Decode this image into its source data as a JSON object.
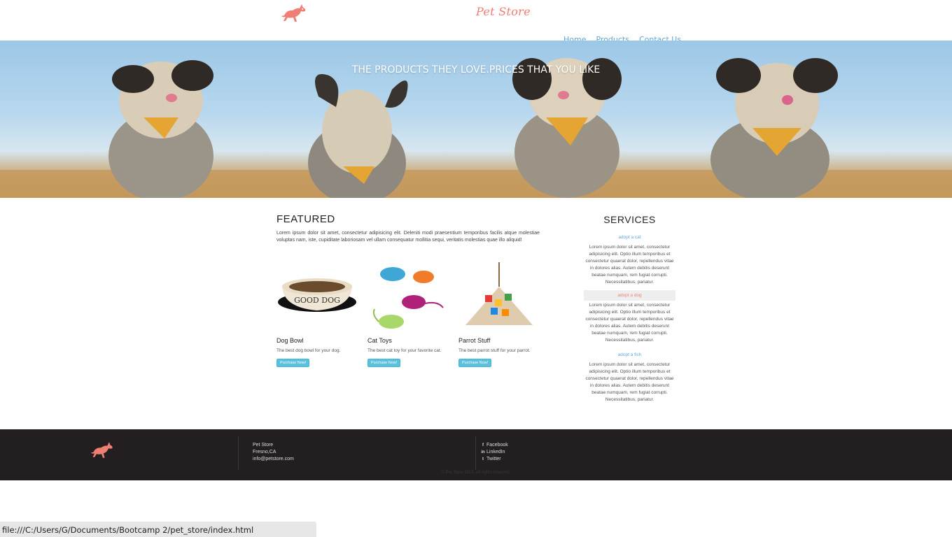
{
  "header": {
    "brand": "Pet Store",
    "nav": [
      "Home",
      "Products",
      "Contact Us"
    ]
  },
  "hero": {
    "caption": "THE PRODUCTS THEY LOVE.PRICES THAT YOU LIKE"
  },
  "featured": {
    "title": "FEATURED",
    "description": "Lorem ipsum dolor sit amet, consectetur adipisicing elit. Deleniti modi praesentium temporibus facilis atque molestiae voluptas nam, iste, cupiditate laboriosam vel ullam consequatur mollitia sequi, veritatis molestias quae illo aliquid!",
    "products": [
      {
        "name": "Dog Bowl",
        "description": "The best dog bowl for your dog.",
        "button": "Purchase Now!",
        "image_text": "GOOD DOG"
      },
      {
        "name": "Cat Toys",
        "description": "The best cat toy for your favorite cat.",
        "button": "Purchase Now!"
      },
      {
        "name": "Parrot Stuff",
        "description": "The best parrot stuff for your parrot.",
        "button": "Purchase Now!"
      }
    ]
  },
  "services": {
    "title": "SERVICES",
    "items": [
      {
        "label": "adopt a cat",
        "text": "Lorem ipsum dolor sit amet, consectetur adipisicing elit. Optio illum temporibus et consectetur quaerat dolor, repellendus vitae in dolores alias. Autem debitis deserunt beatae numquam, rem fugiat corrupti. Necessitatibus, pariatur."
      },
      {
        "label": "adopt a dog",
        "text": "Lorem ipsum dolor sit amet, consectetur adipisicing elit. Optio illum temporibus et consectetur quaerat dolor, repellendus vitae in dolores alias. Autem debitis deserunt beatae numquam, rem fugiat corrupti. Necessitatibus, pariatur."
      },
      {
        "label": "adopt a fish",
        "text": "Lorem ipsum dolor sit amet, consectetur adipisicing elit. Optio illum temporibus et consectetur quaerat dolor, repellendus vitae in dolores alias. Autem debitis deserunt beatae numquam, rem fugiat corrupti. Necessitatibus, pariatur."
      }
    ]
  },
  "footer": {
    "address": [
      "Pet Store",
      "Fresno,CA",
      "info@petstore.com"
    ],
    "social": [
      {
        "icon": "facebook-icon",
        "glyph": "f",
        "label": "Facebook"
      },
      {
        "icon": "linkedin-icon",
        "glyph": "in",
        "label": "LinkedIn"
      },
      {
        "icon": "twitter-icon",
        "glyph": "t",
        "label": "Twitter"
      }
    ],
    "copyright": "© Pet Store 2015. All rights reserved."
  },
  "status_bar": {
    "url": "file:///C:/Users/G/Documents/Bootcamp 2/pet_store/index.html"
  },
  "colors": {
    "brand_coral": "#ef7e74",
    "link_blue": "#5ea7d4",
    "button_info": "#5bc0de",
    "footer_bg": "#231f20"
  }
}
